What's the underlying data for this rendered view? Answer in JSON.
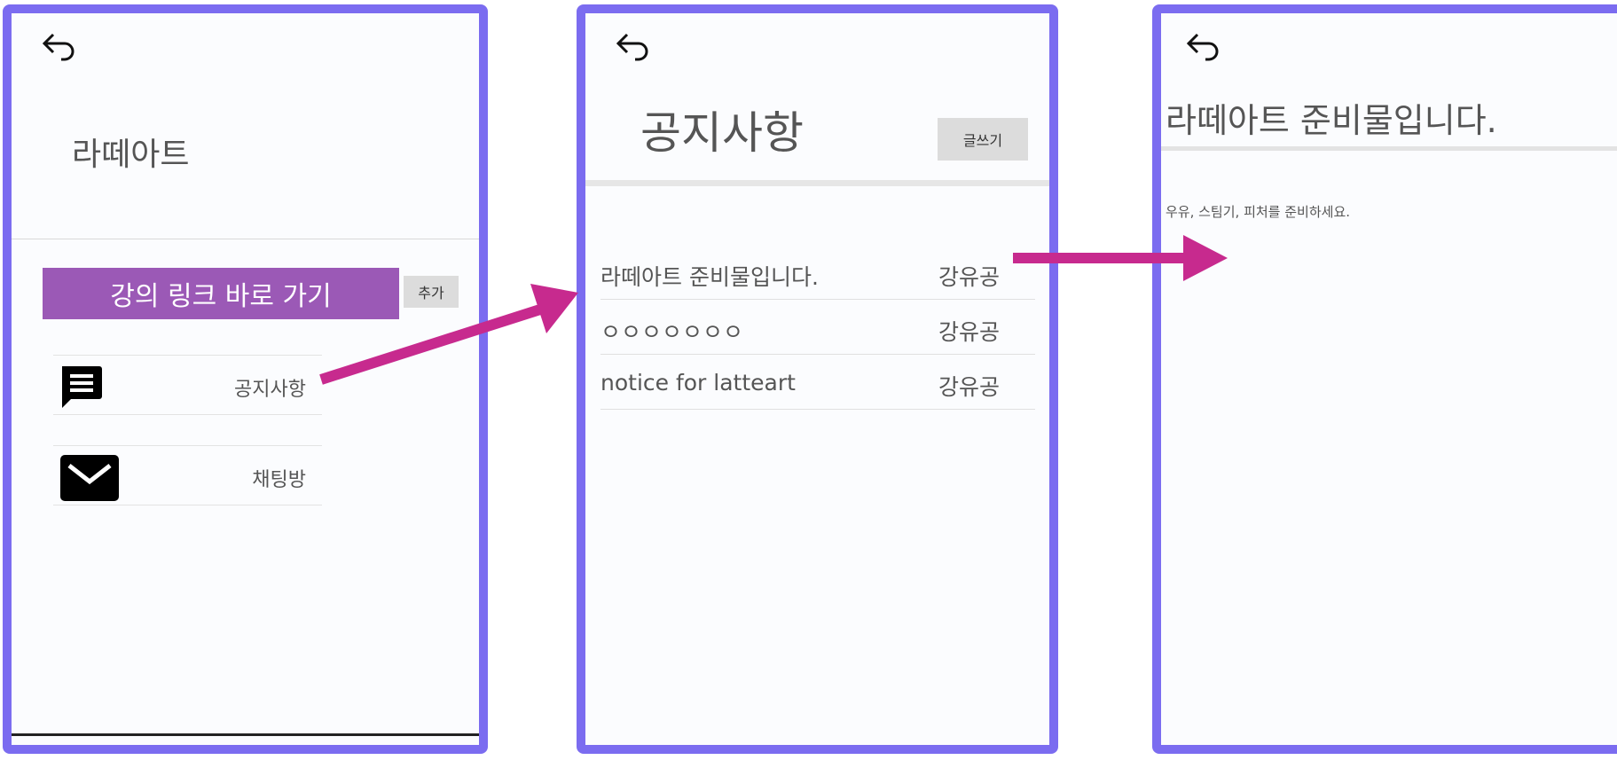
{
  "colors": {
    "frame": "#7b6cf0",
    "link_button": "#9b59b6",
    "arrow": "#c72a8e"
  },
  "screen1": {
    "back_icon": "back-arrow-icon",
    "course_title": "라떼아트",
    "link_button_label": "강의 링크 바로 가기",
    "add_button_label": "추가",
    "menu": [
      {
        "icon": "message-icon",
        "label": "공지사항"
      },
      {
        "icon": "mail-icon",
        "label": "채팅방"
      }
    ]
  },
  "screen2": {
    "back_icon": "back-arrow-icon",
    "title": "공지사항",
    "write_button_label": "글쓰기",
    "posts": [
      {
        "title": "라떼아트 준비물입니다.",
        "author": "강유공"
      },
      {
        "title": "ㅇㅇㅇㅇㅇㅇㅇ",
        "author": "강유공"
      },
      {
        "title": "notice for latteart",
        "author": "강유공"
      }
    ]
  },
  "screen3": {
    "back_icon": "back-arrow-icon",
    "title": "라떼아트 준비물입니다.",
    "body": "우유, 스팀기, 피처를 준비하세요."
  }
}
